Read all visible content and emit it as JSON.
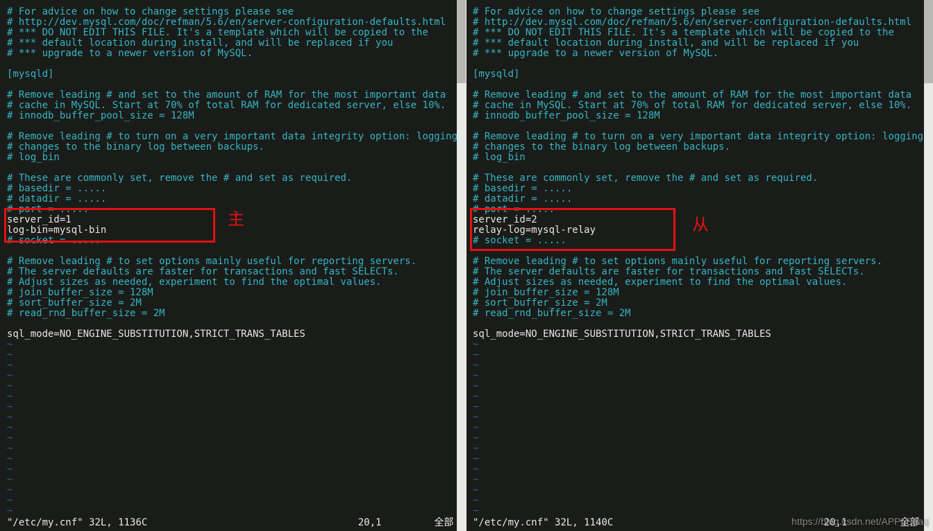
{
  "left": {
    "lines": [
      {
        "cls": "c",
        "text": "# For advice on how to change settings please see"
      },
      {
        "cls": "c",
        "text": "# http://dev.mysql.com/doc/refman/5.6/en/server-configuration-defaults.html"
      },
      {
        "cls": "c",
        "text": "# *** DO NOT EDIT THIS FILE. It's a template which will be copied to the"
      },
      {
        "cls": "c",
        "text": "# *** default location during install, and will be replaced if you"
      },
      {
        "cls": "c",
        "text": "# *** upgrade to a newer version of MySQL."
      },
      {
        "cls": "w",
        "text": ""
      },
      {
        "cls": "s",
        "text": "[mysqld]"
      },
      {
        "cls": "w",
        "text": ""
      },
      {
        "cls": "c",
        "text": "# Remove leading # and set to the amount of RAM for the most important data"
      },
      {
        "cls": "c",
        "text": "# cache in MySQL. Start at 70% of total RAM for dedicated server, else 10%."
      },
      {
        "cls": "c",
        "text": "# innodb_buffer_pool_size = 128M"
      },
      {
        "cls": "w",
        "text": ""
      },
      {
        "cls": "c",
        "text": "# Remove leading # to turn on a very important data integrity option: logging"
      },
      {
        "cls": "c",
        "text": "# changes to the binary log between backups."
      },
      {
        "cls": "c",
        "text": "# log_bin"
      },
      {
        "cls": "w",
        "text": ""
      },
      {
        "cls": "c",
        "text": "# These are commonly set, remove the # and set as required."
      },
      {
        "cls": "c",
        "text": "# basedir = ....."
      },
      {
        "cls": "c",
        "text": "# datadir = ....."
      },
      {
        "cls": "c",
        "text": "# port = ....."
      },
      {
        "cls": "w",
        "text": "server_id=1"
      },
      {
        "cls": "w",
        "text": "log-bin=mysql-bin"
      },
      {
        "cls": "c",
        "text": "# socket = ....."
      },
      {
        "cls": "w",
        "text": ""
      },
      {
        "cls": "c",
        "text": "# Remove leading # to set options mainly useful for reporting servers."
      },
      {
        "cls": "c",
        "text": "# The server defaults are faster for transactions and fast SELECTs."
      },
      {
        "cls": "c",
        "text": "# Adjust sizes as needed, experiment to find the optimal values."
      },
      {
        "cls": "c",
        "text": "# join_buffer_size = 128M"
      },
      {
        "cls": "c",
        "text": "# sort_buffer_size = 2M"
      },
      {
        "cls": "c",
        "text": "# read_rnd_buffer_size = 2M"
      },
      {
        "cls": "w",
        "text": ""
      },
      {
        "cls": "w",
        "text": "sql_mode=NO_ENGINE_SUBSTITUTION,STRICT_TRANS_TABLES"
      }
    ],
    "key1": "server_id=1",
    "key2": "log-bin=mysql-bin",
    "annot": "主",
    "filename": "\"/etc/my.cnf\"",
    "filestat": "32L, 1136C",
    "cursor": "20,1",
    "pos": "全部"
  },
  "right": {
    "lines": [
      {
        "cls": "c",
        "text": "# For advice on how to change settings please see"
      },
      {
        "cls": "c",
        "text": "# http://dev.mysql.com/doc/refman/5.6/en/server-configuration-defaults.html"
      },
      {
        "cls": "c",
        "text": "# *** DO NOT EDIT THIS FILE. It's a template which will be copied to the"
      },
      {
        "cls": "c",
        "text": "# *** default location during install, and will be replaced if you"
      },
      {
        "cls": "c",
        "text": "# *** upgrade to a newer version of MySQL."
      },
      {
        "cls": "w",
        "text": ""
      },
      {
        "cls": "s",
        "text": "[mysqld]"
      },
      {
        "cls": "w",
        "text": ""
      },
      {
        "cls": "c",
        "text": "# Remove leading # and set to the amount of RAM for the most important data"
      },
      {
        "cls": "c",
        "text": "# cache in MySQL. Start at 70% of total RAM for dedicated server, else 10%."
      },
      {
        "cls": "c",
        "text": "# innodb_buffer_pool_size = 128M"
      },
      {
        "cls": "w",
        "text": ""
      },
      {
        "cls": "c",
        "text": "# Remove leading # to turn on a very important data integrity option: logging"
      },
      {
        "cls": "c",
        "text": "# changes to the binary log between backups."
      },
      {
        "cls": "c",
        "text": "# log_bin"
      },
      {
        "cls": "w",
        "text": ""
      },
      {
        "cls": "c",
        "text": "# These are commonly set, remove the # and set as required."
      },
      {
        "cls": "c",
        "text": "# basedir = ....."
      },
      {
        "cls": "c",
        "text": "# datadir = ....."
      },
      {
        "cls": "c",
        "text": "# port = ....."
      },
      {
        "cls": "w",
        "text": "server_id=2"
      },
      {
        "cls": "w",
        "text": "relay-log=mysql-relay"
      },
      {
        "cls": "c",
        "text": "# socket = ....."
      },
      {
        "cls": "w",
        "text": ""
      },
      {
        "cls": "c",
        "text": "# Remove leading # to set options mainly useful for reporting servers."
      },
      {
        "cls": "c",
        "text": "# The server defaults are faster for transactions and fast SELECTs."
      },
      {
        "cls": "c",
        "text": "# Adjust sizes as needed, experiment to find the optimal values."
      },
      {
        "cls": "c",
        "text": "# join_buffer_size = 128M"
      },
      {
        "cls": "c",
        "text": "# sort_buffer_size = 2M"
      },
      {
        "cls": "c",
        "text": "# read_rnd_buffer_size = 2M"
      },
      {
        "cls": "w",
        "text": ""
      },
      {
        "cls": "w",
        "text": "sql_mode=NO_ENGINE_SUBSTITUTION,STRICT_TRANS_TABLES"
      }
    ],
    "key1": "server_id=2",
    "key2": "relay-log=mysql-relay",
    "key3": "# socket = .....",
    "annot": "从",
    "filename": "\"/etc/my.cnf\"",
    "filestat": "32L, 1140C",
    "cursor": "20,1",
    "pos": "全部"
  },
  "tilde": "~",
  "watermark": "https://blog.csdn.net/APPLEaaq"
}
